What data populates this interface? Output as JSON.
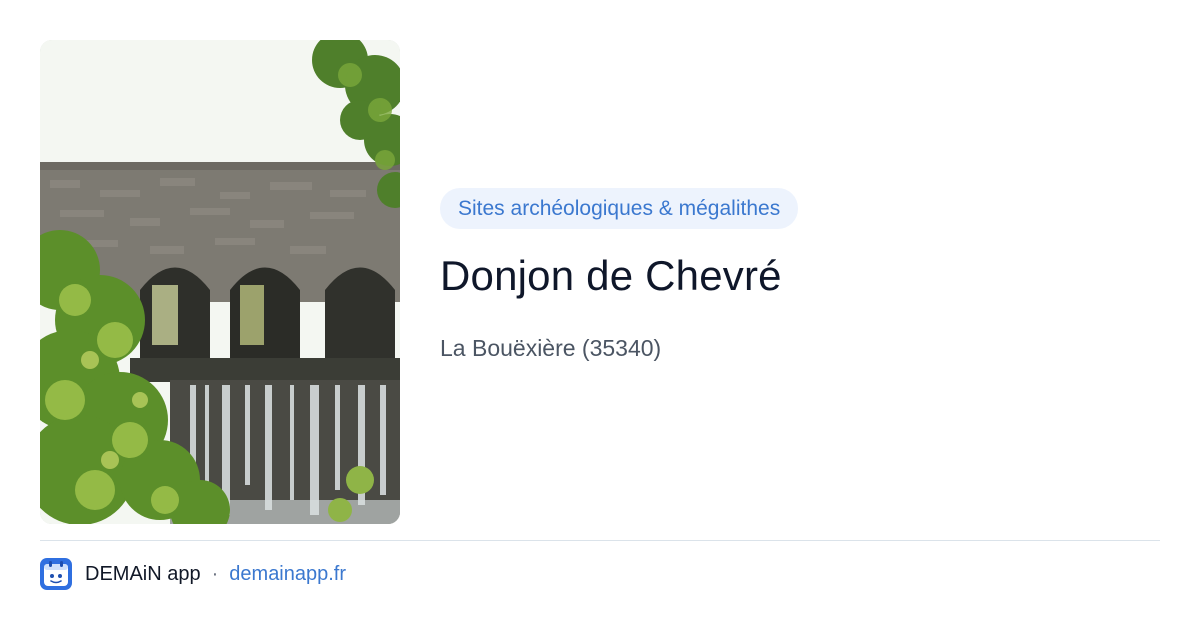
{
  "category": "Sites archéologiques & mégalithes",
  "title": "Donjon de Chevré",
  "location": "La Bouëxière (35340)",
  "footer": {
    "app_name": "DEMAiN app",
    "separator": "·",
    "link": "demainapp.fr"
  },
  "colors": {
    "accent": "#3b78cf",
    "badge_bg": "#edf3fd",
    "title": "#0f172a",
    "muted": "#4b5563"
  },
  "icons": {
    "app": "demain-app-icon"
  }
}
